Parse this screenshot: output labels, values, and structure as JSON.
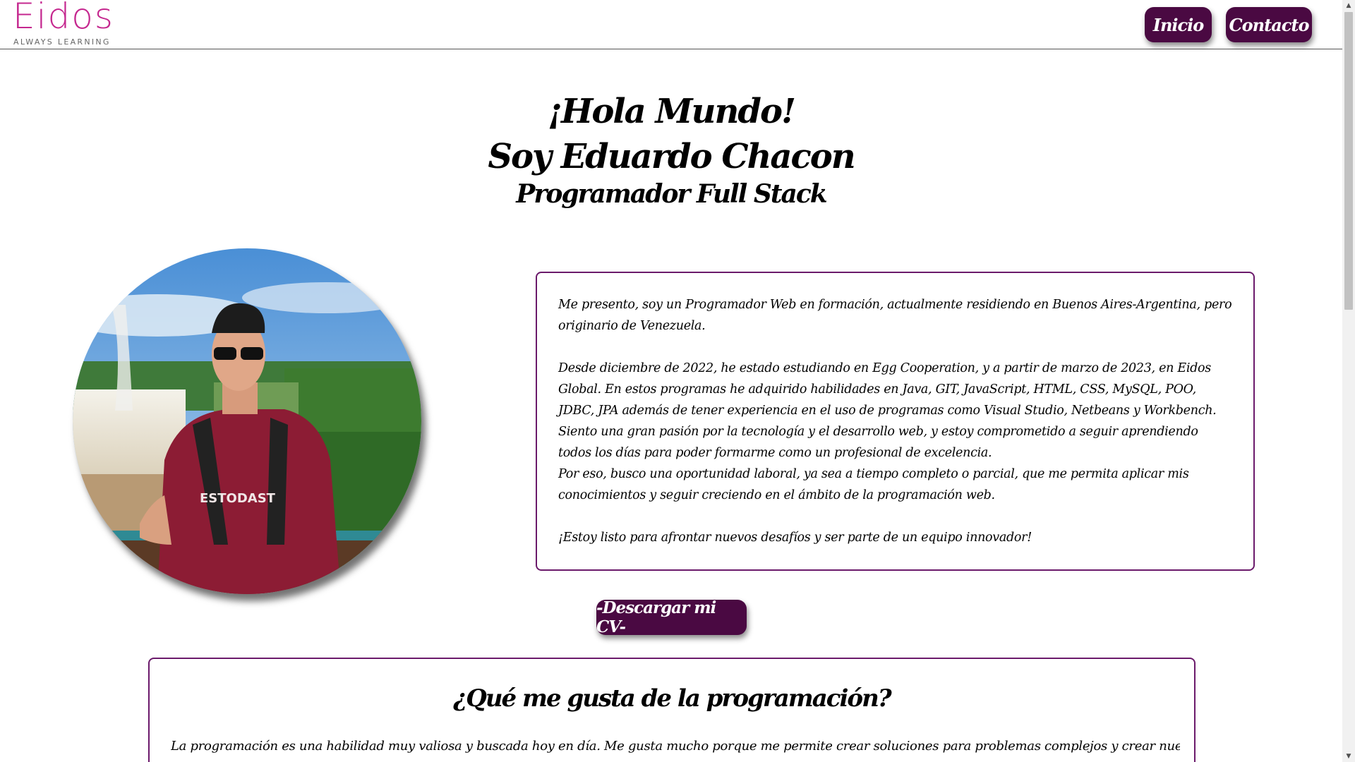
{
  "header": {
    "logo_word": "Eidos",
    "logo_tagline": "ALWAYS LEARNING",
    "nav": [
      {
        "label": "Inicio"
      },
      {
        "label": "Contacto"
      }
    ]
  },
  "hero": {
    "greeting": "¡Hola Mundo!",
    "name": "Soy Eduardo Chacon",
    "role": "Programador Full Stack"
  },
  "photo": {
    "icon": "profile-photo"
  },
  "about": {
    "paragraphs": [
      "Me presento, soy un Programador Web en formación, actualmente residiendo en Buenos Aires-Argentina, pero originario de Venezuela.",
      "Desde diciembre de 2022, he estado estudiando en Egg Cooperation, y a partir de marzo de 2023, en Eidos Global. En estos programas he adquirido habilidades en Java, GIT, JavaScript, HTML, CSS, MySQL, POO, JDBC, JPA además de tener experiencia en el uso de programas como Visual Studio, Netbeans y Workbench.",
      "Siento una gran pasión por la tecnología y el desarrollo web, y estoy comprometido a seguir aprendiendo todos los días para poder formarme como un profesional de excelencia.",
      "Por eso, busco una oportunidad laboral, ya sea a tiempo completo o parcial, que me permita aplicar mis conocimientos y seguir creciendo en el ámbito de la programación web.",
      "¡Estoy listo para afrontar nuevos desafíos y ser parte de un equipo innovador!"
    ]
  },
  "cv_button": {
    "label": "-Descargar mi CV-"
  },
  "section": {
    "title": "¿Qué me gusta de la programación?",
    "text": "La programación es una habilidad muy valiosa y buscada hoy en día. Me gusta mucho porque me permite crear soluciones para problemas complejos y crear nuevas aplicaciones que"
  },
  "colors": {
    "accent": "#4a0942",
    "border": "#6b1a6b",
    "logo": "#c5288f"
  }
}
